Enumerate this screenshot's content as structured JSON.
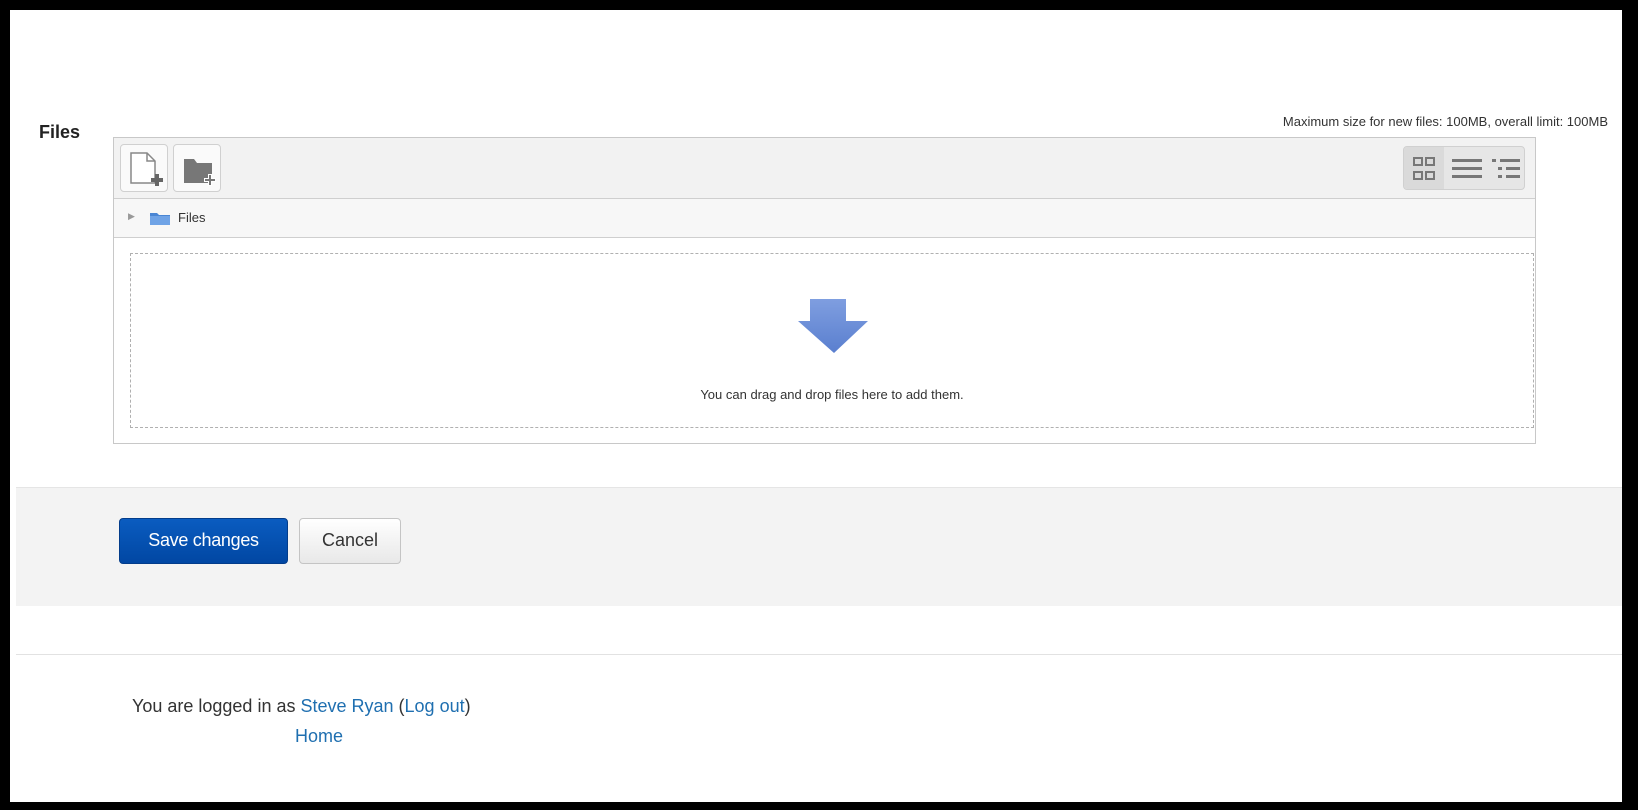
{
  "files_section": {
    "label": "Files",
    "max_size_text": "Maximum size for new files: 100MB, overall limit: 100MB"
  },
  "toolbar": {
    "add_file_icon": "add-file-icon",
    "create_folder_icon": "create-folder-icon",
    "view_icons_icon": "icon-view-icon",
    "view_details_icon": "details-view-icon",
    "view_tree_icon": "tree-view-icon"
  },
  "path": {
    "label": "Files"
  },
  "dropzone": {
    "text": "You can drag and drop files here to add them.",
    "arrow_color": "#6b8fd6"
  },
  "actions": {
    "save_label": "Save changes",
    "cancel_label": "Cancel"
  },
  "footer": {
    "prefix": "You are logged in as ",
    "user_name": "Steve Ryan",
    "open_paren": " (",
    "logout_label": "Log out",
    "close_paren": ")",
    "home_label": "Home"
  }
}
